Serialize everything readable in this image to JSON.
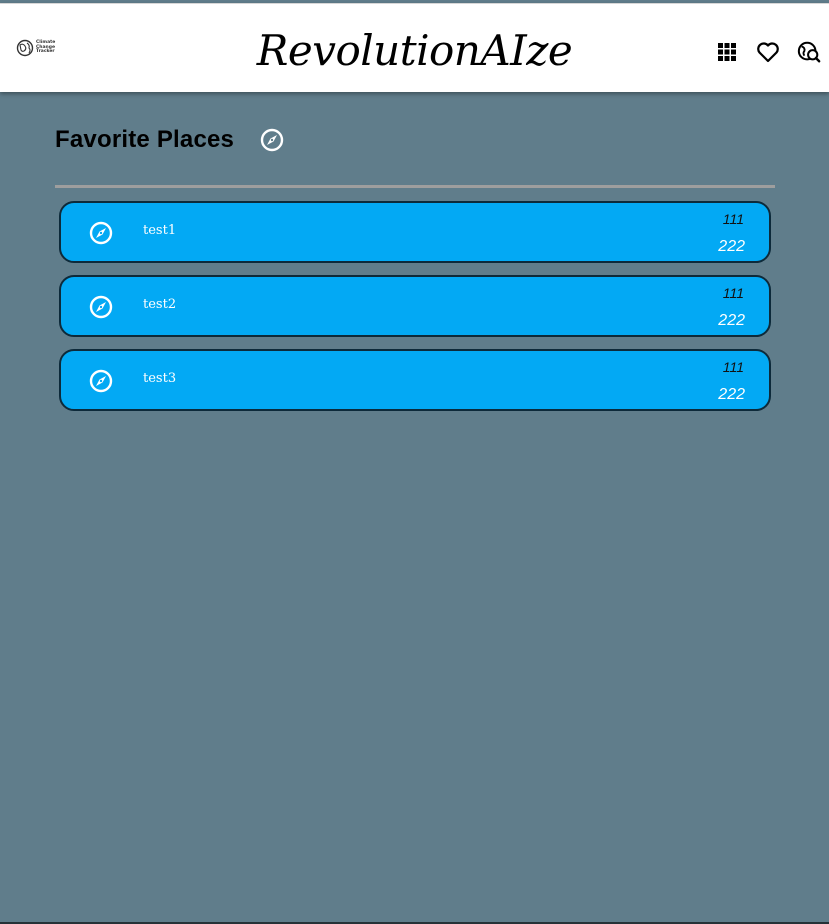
{
  "header": {
    "logo_text": "Climate\nChange\nTracker",
    "title": "RevolutionAIze",
    "icons": [
      "apps-grid-icon",
      "heart-icon",
      "travel-explore-icon"
    ]
  },
  "section": {
    "title": "Favorite Places",
    "icon": "compass-icon"
  },
  "places": [
    {
      "name": "test1",
      "value_top": "111",
      "value_bottom": "222",
      "icon": "compass-icon"
    },
    {
      "name": "test2",
      "value_top": "111",
      "value_bottom": "222",
      "icon": "compass-icon"
    },
    {
      "name": "test3",
      "value_top": "111",
      "value_bottom": "222",
      "icon": "compass-icon"
    }
  ],
  "colors": {
    "page_bg": "#607d8b",
    "header_bg": "#ffffff",
    "card_bg": "#03a9f4",
    "card_border": "#0d2a3a",
    "divider": "#9e9e9e"
  }
}
